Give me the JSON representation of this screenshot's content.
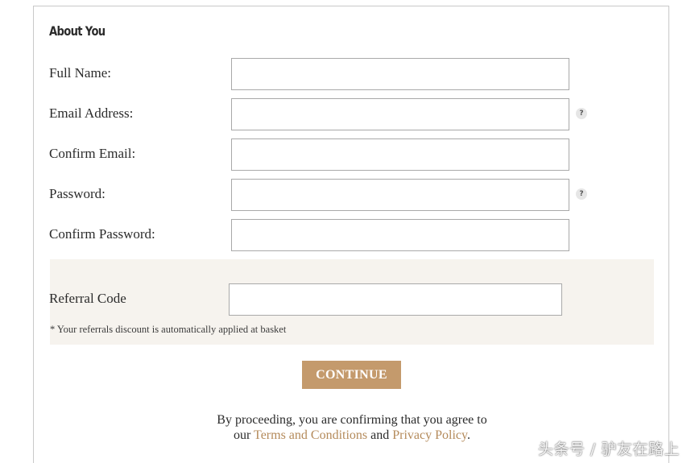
{
  "form": {
    "section_title": "About You",
    "fields": [
      {
        "label": "Full Name:",
        "value": "",
        "has_help": false
      },
      {
        "label": "Email Address:",
        "value": "",
        "has_help": true
      },
      {
        "label": "Confirm Email:",
        "value": "",
        "has_help": false
      },
      {
        "label": "Password:",
        "value": "",
        "has_help": true
      },
      {
        "label": "Confirm Password:",
        "value": "",
        "has_help": false
      }
    ],
    "help_glyph": "?"
  },
  "referral": {
    "label": "Referral Code",
    "value": "",
    "note": "* Your referrals discount is automatically applied at basket"
  },
  "actions": {
    "continue_label": "CONTINUE"
  },
  "legal": {
    "line1": "By proceeding, you are confirming that you agree to",
    "prefix": "our",
    "terms_link": "Terms and Conditions",
    "conjunction": "and",
    "privacy_link": "Privacy Policy",
    "suffix": "."
  },
  "watermark": {
    "text": "头条号 / 驴友在路上"
  },
  "colors": {
    "accent": "#c49a6c",
    "link": "#b48a5a",
    "referral_bg": "#f6f3ee",
    "border": "#a9a9a9"
  }
}
